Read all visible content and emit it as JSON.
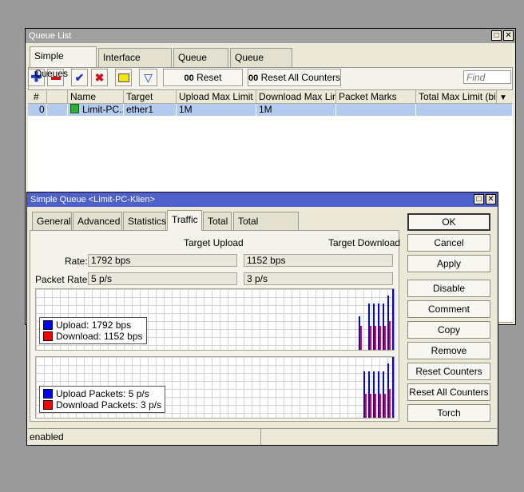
{
  "queue_list": {
    "title": "Queue List",
    "tabs": [
      "Simple Queues",
      "Interface Queues",
      "Queue Tree",
      "Queue Types"
    ],
    "active_tab": 0,
    "toolbar": {
      "reset_counters": "Reset Counters",
      "reset_all_counters": "Reset All Counters",
      "counter_prefix": "00",
      "find_placeholder": "Find"
    },
    "columns": [
      "#",
      "",
      "Name",
      "Target",
      "Upload Max Limit",
      "Download Max Limit",
      "Packet Marks",
      "Total Max Limit (bi..."
    ],
    "rows": [
      {
        "num": "0",
        "name": "Limit-PC...",
        "target": "ether1",
        "upload": "1M",
        "download": "1M",
        "marks": "",
        "total": ""
      }
    ]
  },
  "simple_queue": {
    "title": "Simple Queue <Limit-PC-Klien>",
    "tabs": [
      "General",
      "Advanced",
      "Statistics",
      "Traffic",
      "Total",
      "Total Statistics"
    ],
    "active_tab": 3,
    "target_upload_label": "Target Upload",
    "target_download_label": "Target Download",
    "rate_label": "Rate:",
    "rate_upload": "1792 bps",
    "rate_download": "1152 bps",
    "packet_rate_label": "Packet Rate:",
    "packet_rate_upload": "5 p/s",
    "packet_rate_download": "3 p/s",
    "graph1_legend": {
      "upload": "Upload:  1792 bps",
      "download": "Download:  1152 bps"
    },
    "graph2_legend": {
      "upload": "Upload Packets:  5 p/s",
      "download": "Download Packets:  3 p/s"
    },
    "buttons": [
      "OK",
      "Cancel",
      "Apply",
      "Disable",
      "Comment",
      "Copy",
      "Remove",
      "Reset Counters",
      "Reset All Counters",
      "Torch"
    ],
    "status": "enabled"
  },
  "colors": {
    "titlebar": "#4e60c9",
    "selected_row": "#b4cbef",
    "upload": "#0000ff",
    "download": "#ff0000"
  }
}
